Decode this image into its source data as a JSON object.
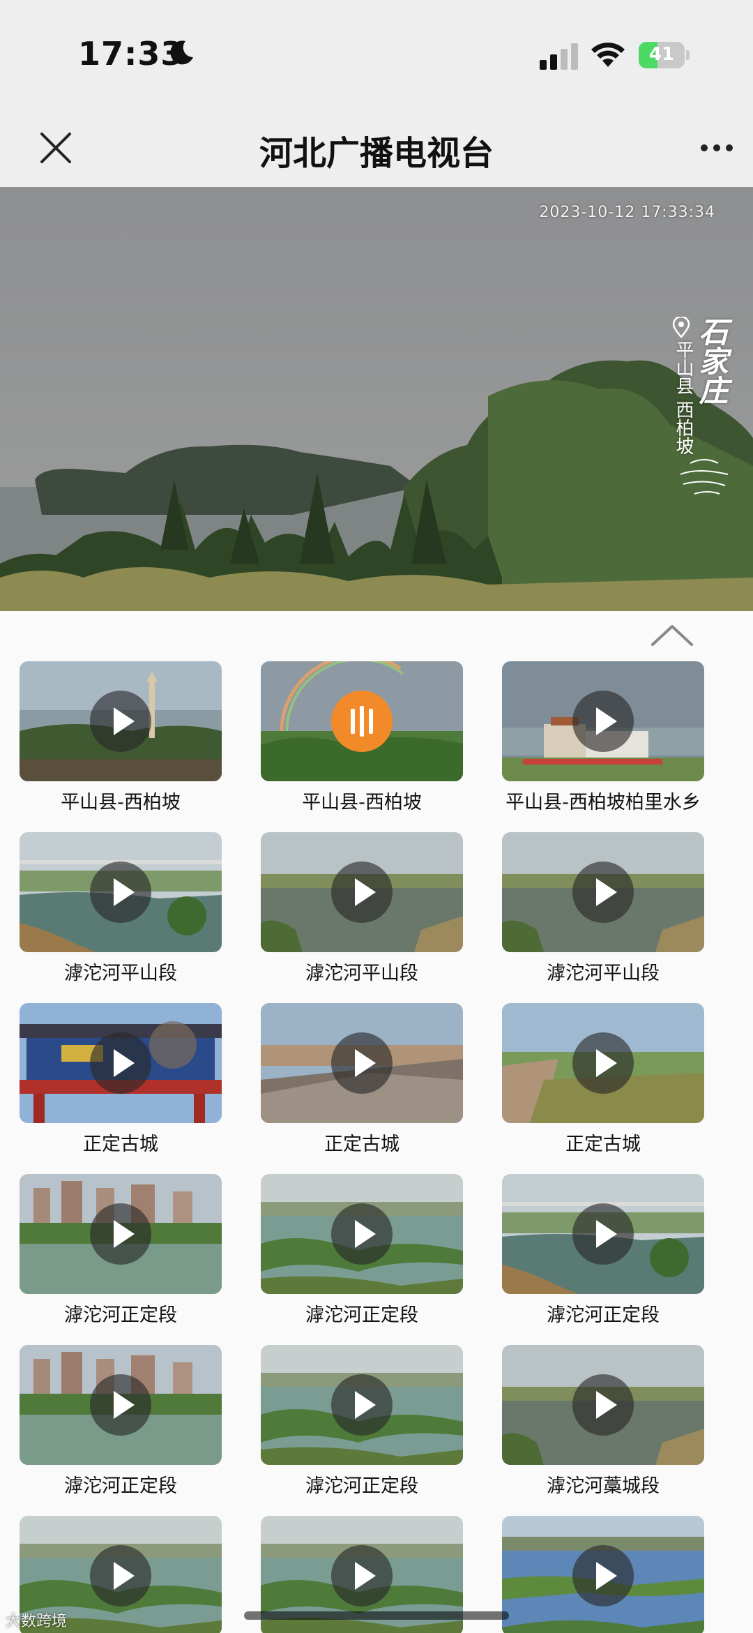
{
  "status_bar": {
    "time": "17:33",
    "battery_level": "41",
    "icons": [
      "moon-icon",
      "signal-icon",
      "wifi-icon",
      "battery-icon"
    ]
  },
  "nav": {
    "title": "河北广播电视台",
    "icons": [
      "close-icon",
      "more-icon"
    ]
  },
  "player": {
    "timestamp": "2023-10-12 17:33:34",
    "location_city": "石家庄",
    "location_area": "平山县 西柏坡"
  },
  "channels": [
    {
      "title": "平山县-西柏坡",
      "playing": false,
      "theme": "tower"
    },
    {
      "title": "平山县-西柏坡",
      "playing": true,
      "theme": "rainbow"
    },
    {
      "title": "平山县-西柏坡柏里水乡",
      "playing": false,
      "theme": "resort"
    },
    {
      "title": "滹沱河平山段",
      "playing": false,
      "theme": "river-bridge"
    },
    {
      "title": "滹沱河平山段",
      "playing": false,
      "theme": "river"
    },
    {
      "title": "滹沱河平山段",
      "playing": false,
      "theme": "river"
    },
    {
      "title": "正定古城",
      "playing": false,
      "theme": "gate"
    },
    {
      "title": "正定古城",
      "playing": false,
      "theme": "wall"
    },
    {
      "title": "正定古城",
      "playing": false,
      "theme": "wall-green"
    },
    {
      "title": "滹沱河正定段",
      "playing": false,
      "theme": "city-lake"
    },
    {
      "title": "滹沱河正定段",
      "playing": false,
      "theme": "wetland"
    },
    {
      "title": "滹沱河正定段",
      "playing": false,
      "theme": "river-bridge"
    },
    {
      "title": "滹沱河正定段",
      "playing": false,
      "theme": "city-lake"
    },
    {
      "title": "滹沱河正定段",
      "playing": false,
      "theme": "wetland"
    },
    {
      "title": "滹沱河藁城段",
      "playing": false,
      "theme": "river"
    },
    {
      "title": "",
      "playing": false,
      "theme": "wetland"
    },
    {
      "title": "",
      "playing": false,
      "theme": "wetland"
    },
    {
      "title": "",
      "playing": false,
      "theme": "blue-lake"
    }
  ],
  "watermark": "大数跨境",
  "colors": {
    "accent_playing": "#f38a2a",
    "battery_green": "#4cd964"
  }
}
